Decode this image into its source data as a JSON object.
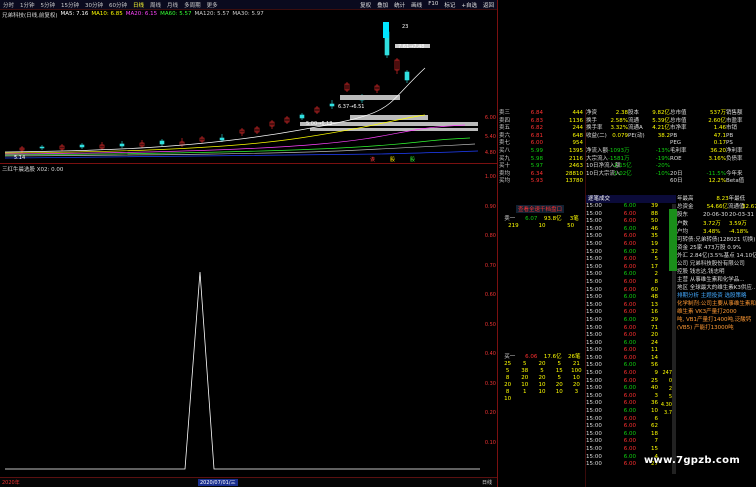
{
  "toolbar": {
    "items": [
      "分时",
      "1分钟",
      "5分钟",
      "15分钟",
      "30分钟",
      "60分钟",
      "日线",
      "周线",
      "月线",
      "多周期",
      "更多"
    ],
    "active_index": 6,
    "right_items": [
      "复权",
      "叠加",
      "统计",
      "画线",
      "F10",
      "标记",
      "+自选",
      "返回"
    ]
  },
  "ma_legend": {
    "name": "兄弟科技(日线,前复权)",
    "items": [
      {
        "text": "MA5: 7.16",
        "color": "#ffffff"
      },
      {
        "text": "MA10: 6.85",
        "color": "#ffff00"
      },
      {
        "text": "MA20: 6.15",
        "color": "#ff44ff"
      },
      {
        "text": "MA60: 5.57",
        "color": "#33ff33"
      },
      {
        "text": "MA120: 5.57",
        "color": "#cccccc"
      },
      {
        "text": "MA30: 5.97",
        "color": "#cccccc"
      }
    ]
  },
  "price_chart": {
    "axis_labels": [
      "6.00",
      "5.40",
      "4.80"
    ],
    "annotations": {
      "high": "7.61→7.48",
      "mid": "6.37→6.51",
      "low": "5.00→6.13",
      "bottom": "5.14"
    },
    "top_label": "23",
    "marks": [
      "诶",
      "股",
      "股"
    ]
  },
  "indicator": {
    "title": "三红牛晨选股  X02: 0.00",
    "axis_labels": [
      "1.00",
      "0.90",
      "0.80",
      "0.70",
      "0.60",
      "0.50",
      "0.40",
      "0.30",
      "0.20",
      "0.10"
    ],
    "spike_label": "2020/07/01/三",
    "date_left": "2020年",
    "date_right": "日线"
  },
  "order_book_top": {
    "rows": [
      {
        "label": "卖三",
        "price": "6.84",
        "vol": "444"
      },
      {
        "label": "卖四",
        "price": "6.83",
        "vol": "1136"
      },
      {
        "label": "卖五",
        "price": "6.82",
        "vol": "244"
      },
      {
        "label": "卖六",
        "price": "6.81",
        "vol": "648"
      },
      {
        "label": "卖七",
        "price": "6.00",
        "vol": "954"
      },
      {
        "label": "买八",
        "price": "5.99",
        "vol": "1395"
      },
      {
        "label": "买九",
        "price": "5.98",
        "vol": "2116"
      },
      {
        "label": "买十",
        "price": "5.97",
        "vol": "2463"
      },
      {
        "label": "卖均",
        "price": "6.34",
        "vol": "28810"
      },
      {
        "label": "买均",
        "price": "5.93",
        "vol": "13780"
      }
    ],
    "extra": [
      "总卖",
      "总买"
    ]
  },
  "quote": {
    "rows": [
      [
        {
          "k": "净资",
          "v": "2.38"
        },
        {
          "k": "股本",
          "v": "9.82亿"
        },
        {
          "k": "总市值",
          "v": "537万"
        },
        {
          "k": "销售额",
          "v": "2780万"
        }
      ],
      [
        {
          "k": "换手",
          "v": "2.58%"
        },
        {
          "k": "流通",
          "v": "5.39亿"
        },
        {
          "k": "总市值",
          "v": "2.60亿"
        },
        {
          "k": "市盈率",
          "v": "41.0"
        }
      ],
      [
        {
          "k": "换手率",
          "v": "3.32%"
        },
        {
          "k": "流通A",
          "v": "4.21亿"
        },
        {
          "k": "市净率",
          "v": "1.46"
        },
        {
          "k": "市销",
          "v": "1.51"
        }
      ],
      [
        {
          "k": "收益(二)",
          "v": "0.079"
        },
        {
          "k": "PE(动)",
          "v": "38.2"
        },
        {
          "k": "PB",
          "v": "47.1"
        },
        {
          "k": "PB",
          "v": "2.86"
        }
      ],
      [
        {
          "k": "",
          "v": ""
        },
        {
          "k": "",
          "v": ""
        },
        {
          "k": "PEG",
          "v": "0.17"
        },
        {
          "k": "PS",
          "v": "1.56"
        }
      ],
      [
        {
          "k": "净流入额",
          "v": "-1093万"
        },
        {
          "k": "",
          "v": "-13%"
        },
        {
          "k": "毛利率",
          "v": "36.20"
        },
        {
          "k": "净利率",
          "v": "3.44"
        }
      ],
      [
        {
          "k": "大宗流入",
          "v": "-1581万"
        },
        {
          "k": "",
          "v": "-19%"
        },
        {
          "k": "ROE",
          "v": "3.16%"
        },
        {
          "k": "负债率",
          "v": "50.94"
        }
      ],
      [
        {
          "k": "10日净流入额",
          "v": "-2.15亿"
        },
        {
          "k": "",
          "v": "-20%"
        },
        {
          "k": "",
          "v": ""
        },
        {
          "k": "",
          "v": ""
        }
      ],
      [
        {
          "k": "10日大宗流入",
          "v": "-1.02亿"
        },
        {
          "k": "",
          "v": "-10%"
        },
        {
          "k": "20日",
          "v": "-11.5%"
        },
        {
          "k": "今年来",
          "v": "24.2%"
        }
      ],
      [
        {
          "k": "",
          "v": ""
        },
        {
          "k": "",
          "v": ""
        },
        {
          "k": "60日",
          "v": "12.2%"
        },
        {
          "k": "Beta值",
          "v": "1.12"
        }
      ]
    ]
  },
  "order_book_bottom": {
    "header": [
      "卖一",
      "6.07",
      "93.8亿",
      "3笔"
    ],
    "sub": [
      "219",
      "10",
      "50"
    ],
    "buy_header": [
      "买一",
      "6.06",
      "17.6亿",
      "26笔"
    ],
    "rows": [
      [
        "25",
        "5",
        "20",
        "5",
        "21"
      ],
      [
        "5",
        "38",
        "5",
        "15",
        "100"
      ],
      [
        "8",
        "20",
        "20",
        "5",
        "10"
      ],
      [
        "20",
        "10",
        "10",
        "20",
        "20"
      ],
      [
        "8",
        "1",
        "10",
        "10",
        "3"
      ],
      [
        "10",
        "",
        "",
        "",
        ""
      ]
    ]
  },
  "alert": "查看全速千档盘口",
  "ticks": {
    "header": "逐笔成交",
    "rows": [
      {
        "t": "15:00",
        "p": "6.00",
        "n": "39"
      },
      {
        "t": "15:00",
        "p": "6.00",
        "n": "88"
      },
      {
        "t": "15:00",
        "p": "6.00",
        "n": "50"
      },
      {
        "t": "15:00",
        "p": "6.00",
        "n": "46"
      },
      {
        "t": "15:00",
        "p": "6.00",
        "n": "35"
      },
      {
        "t": "15:00",
        "p": "6.00",
        "n": "19"
      },
      {
        "t": "15:00",
        "p": "6.00",
        "n": "32"
      },
      {
        "t": "15:00",
        "p": "6.00",
        "n": "5"
      },
      {
        "t": "15:00",
        "p": "6.00",
        "n": "17"
      },
      {
        "t": "15:00",
        "p": "6.00",
        "n": "2"
      },
      {
        "t": "15:00",
        "p": "6.00",
        "n": "8"
      },
      {
        "t": "15:00",
        "p": "6.00",
        "n": "60"
      },
      {
        "t": "15:00",
        "p": "6.00",
        "n": "48"
      },
      {
        "t": "15:00",
        "p": "6.00",
        "n": "13"
      },
      {
        "t": "15:00",
        "p": "6.00",
        "n": "16"
      },
      {
        "t": "15:00",
        "p": "6.00",
        "n": "29"
      },
      {
        "t": "15:00",
        "p": "6.00",
        "n": "71"
      },
      {
        "t": "15:00",
        "p": "6.00",
        "n": "20"
      },
      {
        "t": "15:00",
        "p": "6.00",
        "n": "24"
      },
      {
        "t": "15:00",
        "p": "6.00",
        "n": "11"
      },
      {
        "t": "15:00",
        "p": "6.00",
        "n": "14"
      },
      {
        "t": "15:00",
        "p": "6.00",
        "n": "56"
      },
      {
        "t": "15:00",
        "p": "6.00",
        "n": "9"
      },
      {
        "t": "15:00",
        "p": "6.00",
        "n": "25"
      },
      {
        "t": "15:00",
        "p": "6.00",
        "n": "40"
      },
      {
        "t": "15:00",
        "p": "6.00",
        "n": "3"
      },
      {
        "t": "15:00",
        "p": "6.00",
        "n": "36"
      },
      {
        "t": "15:00",
        "p": "6.00",
        "n": "10"
      },
      {
        "t": "15:00",
        "p": "6.00",
        "n": "6"
      },
      {
        "t": "15:00",
        "p": "6.00",
        "n": "62"
      },
      {
        "t": "15:00",
        "p": "6.00",
        "n": "18"
      },
      {
        "t": "15:00",
        "p": "6.00",
        "n": "7"
      },
      {
        "t": "15:00",
        "p": "6.00",
        "n": "15"
      },
      {
        "t": "15:00",
        "p": "6.00",
        "n": "4"
      },
      {
        "t": "15:00",
        "p": "6.00",
        "n": "27"
      }
    ]
  },
  "fund": {
    "stats": [
      {
        "k": "年最高",
        "v": "8.23",
        "k2": "年最低",
        "v2": ""
      },
      {
        "k": "总资金",
        "v": "54.66亿",
        "k2": "流通值",
        "v2": "32.67亿"
      }
    ],
    "compare_header": [
      "股东",
      "20-06-30",
      "20-03-31"
    ],
    "compare_rows": [
      [
        "户数",
        "3.72万",
        "3.59万"
      ],
      [
        "户均",
        "3.48%",
        "-4.18%"
      ]
    ],
    "bond": "可转债:兄弟转债(128021 切换)",
    "lines": [
      "资金   25家     473万股  0.9%",
      "外汇   2.84亿(3.5%基点  14.10亿(4",
      "公司  兄弟科技股份有限公司",
      "控股  钱志达,钱志明",
      "主营  从事维生素和化学品...",
      "地区  全球最大的维生素K3供应...",
      "排期分析   主题投资   选股策略",
      "化学制剂:公司主要从事维生素和化",
      "维生素  VK3产量打2000",
      "吨, VB1产量打1400吨,泛酸钙",
      "(VB5) 产能打13000吨"
    ],
    "side_values": [
      "247",
      "0",
      "2",
      "5",
      "4.30",
      "3.7"
    ]
  },
  "watermark": "www.7gpzb.com"
}
